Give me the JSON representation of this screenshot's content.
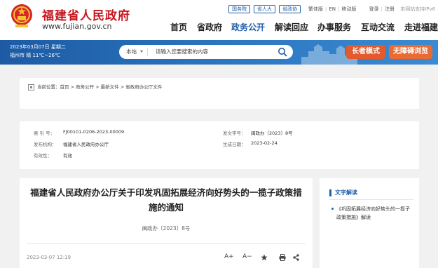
{
  "header": {
    "title": "福建省人民政府",
    "url": "www.fujian.gov.cn",
    "top_links": [
      "国务院",
      "省人大",
      "省政协"
    ],
    "util_links": [
      "繁体版",
      "EN",
      "移动版",
      "登录",
      "注册"
    ],
    "ipv6": "本网站支持IPv6",
    "nav": [
      "首页",
      "省政府",
      "政务公开",
      "解读回应",
      "办事服务",
      "互动交流",
      "走进福建"
    ]
  },
  "banner": {
    "date": "2023年03月07日 星期二",
    "weather": "福州市 晴 11℃~26℃",
    "search_scope": "本站",
    "search_placeholder": "请输入您要搜索的内容",
    "elder_mode": "长者模式",
    "accessible": "无障碍浏览"
  },
  "breadcrumb": "当前位置：首页 > 政务公开 > 最新文件 > 省政府办公厅文件",
  "meta": {
    "index_label": "索 引 号：",
    "index_value": "FJ00101-0206-2023-00009",
    "docnum_label": "发文字号：",
    "docnum_value": "闽政办〔2023〕8号",
    "issuer_label": "发布机构：",
    "issuer_value": "福建省人民政府办公厅",
    "date_label": "生成日期：",
    "date_value": "2023-02-24",
    "validity_label": "有效性：",
    "validity_value": "有效"
  },
  "article": {
    "title": "福建省人民政府办公厅关于印发巩固拓展经济向好势头的一揽子政策措施的通知",
    "doc_no": "闽政办〔2023〕8号",
    "published": "2023-03-07 12:19",
    "tools": [
      "A+",
      "A−"
    ]
  },
  "sidebar": {
    "title": "文字解读",
    "link": "《巩固拓展经济向好势头的一揽子政策措施》解读"
  },
  "colors": {
    "brand_red": "#c8161e",
    "brand_blue": "#1f5fa8",
    "orange": "#e25a2d"
  }
}
